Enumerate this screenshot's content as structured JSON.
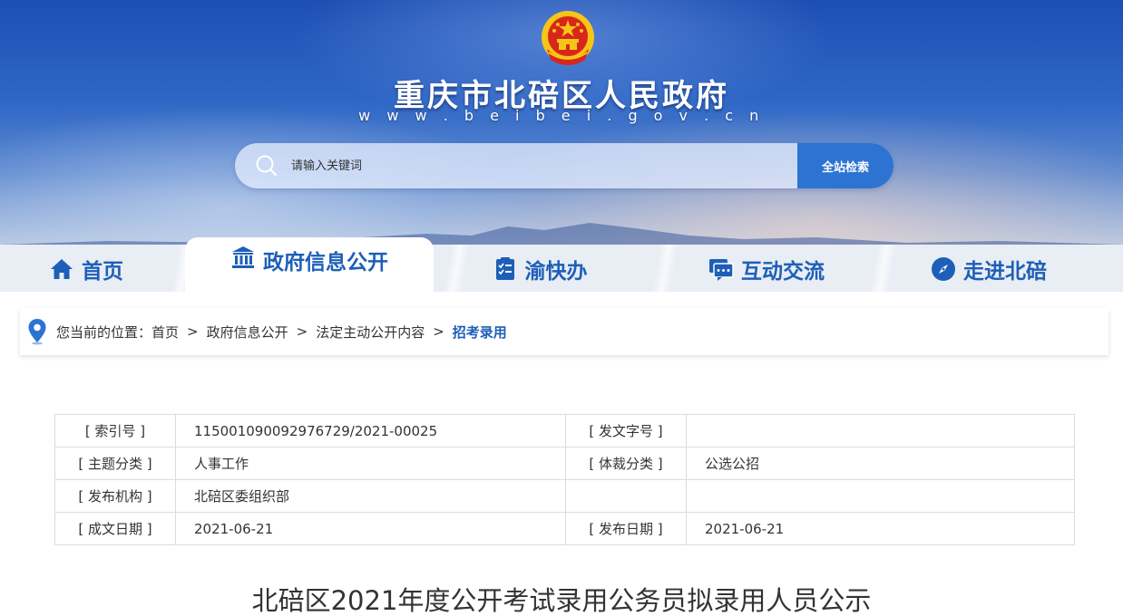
{
  "site": {
    "title": "重庆市北碚区人民政府",
    "url": "w w w . b e i b e i . g o v . c n"
  },
  "search": {
    "placeholder": "请输入关键词",
    "button_label": "全站检索"
  },
  "nav": {
    "items": [
      {
        "label": "首页",
        "icon": "home-icon"
      },
      {
        "label": "政府信息公开",
        "icon": "government-building-icon",
        "active": true
      },
      {
        "label": "渝快办",
        "icon": "checklist-icon"
      },
      {
        "label": "互动交流",
        "icon": "chat-icon"
      },
      {
        "label": "走进北碚",
        "icon": "compass-icon"
      }
    ]
  },
  "breadcrumb": {
    "prefix": "您当前的位置：",
    "items": [
      "首页",
      "政府信息公开",
      "法定主动公开内容"
    ],
    "current": "招考录用",
    "separator": ">"
  },
  "info": {
    "index_label": "[ 索引号 ]",
    "index_value": "115001090092976729/2021-00025",
    "doc_no_label": "[ 发文字号 ]",
    "doc_no_value": "",
    "topic_label": "[ 主题分类 ]",
    "topic_value": "人事工作",
    "genre_label": "[ 体裁分类 ]",
    "genre_value": "公选公招",
    "org_label": "[ 发布机构 ]",
    "org_value": "北碚区委组织部",
    "written_label": "[ 成文日期 ]",
    "written_value": "2021-06-21",
    "published_label": "[ 发布日期 ]",
    "published_value": "2021-06-21"
  },
  "document": {
    "title": "北碚区2021年度公开考试录用公务员拟录用人员公示"
  },
  "colors": {
    "primary": "#1d5fb8",
    "button": "#2d73d2",
    "emblem_red": "#d8261c",
    "emblem_gold": "#f5c518"
  }
}
